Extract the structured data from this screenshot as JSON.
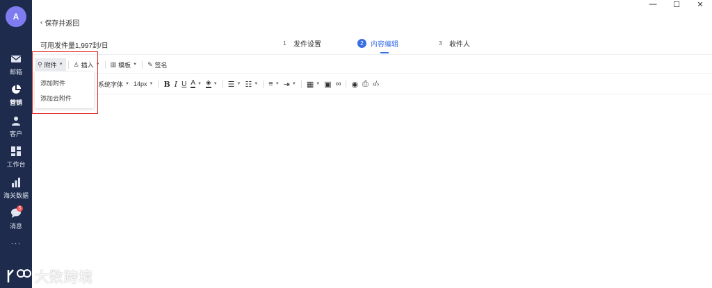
{
  "sidebar": {
    "avatar_letter": "A",
    "items": [
      {
        "label": "邮箱",
        "icon": "mail-icon"
      },
      {
        "label": "营销",
        "icon": "pie-chart-icon"
      },
      {
        "label": "客户",
        "icon": "user-group-icon"
      },
      {
        "label": "工作台",
        "icon": "dashboard-icon"
      },
      {
        "label": "海关数据",
        "icon": "bar-chart-icon"
      },
      {
        "label": "消息",
        "icon": "chat-bubble-icon",
        "badge": "5"
      }
    ],
    "more": "···"
  },
  "window": {
    "minimize": "—",
    "maximize": "☐",
    "close": "✕"
  },
  "header": {
    "back_label": "保存并返回",
    "quota": "可用发件量1,997封/日"
  },
  "steps": [
    {
      "num": "1",
      "label": "发件设置"
    },
    {
      "num": "2",
      "label": "内容编辑",
      "active": true
    },
    {
      "num": "3",
      "label": "收件人"
    }
  ],
  "toolbar1": {
    "attach": "附件",
    "insert": "插入",
    "template": "模板",
    "signature": "签名"
  },
  "toolbar2": {
    "font_family": "系统字体",
    "font_size": "14px",
    "bold": "B",
    "italic": "I",
    "underline": "U",
    "font_color": "A"
  },
  "dropdown": {
    "items": [
      "添加附件",
      "添加云附件"
    ]
  },
  "watermark": {
    "text": "大数跨境"
  },
  "colors": {
    "sidebar": "#1f2b4d",
    "accent": "#3a6fe4",
    "highlight": "#e02e2e",
    "avatar": "#7e7cf0"
  }
}
